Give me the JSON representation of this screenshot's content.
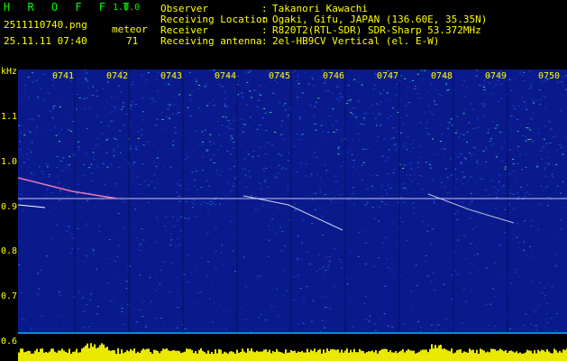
{
  "header": {
    "app_title": "H R O F F T",
    "version": "1.0.0",
    "filename": "2511110740.png",
    "meteor_label": "meteor",
    "datetime": "25.11.11 07:40",
    "meteor_count": "71"
  },
  "info": [
    {
      "label": "Observer",
      "value": "Takanori Kawachi"
    },
    {
      "label": "Receiving Location",
      "value": "Ogaki, Gifu, JAPAN (136.60E, 35.35N)"
    },
    {
      "label": "Receiver",
      "value": "R820T2(RTL-SDR) SDR-Sharp 53.372MHz"
    },
    {
      "label": "Receiving antenna",
      "value": "2el-HB9CV Vertical (el. E-W)"
    }
  ],
  "axis": {
    "unit": "kHz",
    "y_ticks": [
      "1.1",
      "1.0",
      "0.9",
      "0.8",
      "0.7",
      "0.6"
    ],
    "time_ticks": [
      "0741",
      "0742",
      "0743",
      "0744",
      "0745",
      "0746",
      "0747",
      "0748",
      "0749",
      "0750"
    ]
  },
  "colors": {
    "title": "#00ff00",
    "text": "#ffff00",
    "background": "#000000",
    "spectrogram_base": "#0a1a8c",
    "trace": "#ffffff",
    "baseline": "#00ffff"
  }
}
